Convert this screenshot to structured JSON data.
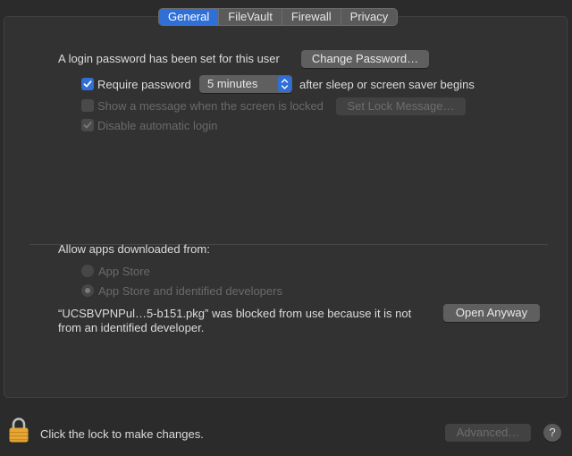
{
  "tabs": [
    {
      "label": "General",
      "active": true
    },
    {
      "label": "FileVault",
      "active": false
    },
    {
      "label": "Firewall",
      "active": false
    },
    {
      "label": "Privacy",
      "active": false
    }
  ],
  "login": {
    "text": "A login password has been set for this user",
    "change_password_label": "Change Password…"
  },
  "require_password": {
    "label": "Require password",
    "checked": true,
    "select_value": "5 minutes",
    "suffix": "after sleep or screen saver begins"
  },
  "show_message": {
    "label": "Show a message when the screen is locked",
    "checked": false,
    "enabled": false,
    "button_label": "Set Lock Message…"
  },
  "disable_auto_login": {
    "label": "Disable automatic login",
    "checked": true,
    "enabled": false
  },
  "allow_apps": {
    "heading": "Allow apps downloaded from:",
    "options": [
      {
        "label": "App Store",
        "selected": false
      },
      {
        "label": "App Store and identified developers",
        "selected": true
      }
    ]
  },
  "blocked": {
    "line1": "“UCSBVPNPul…5-b151.pkg” was blocked from use because it is not",
    "line2": "from an identified developer.",
    "open_anyway_label": "Open Anyway"
  },
  "footer": {
    "lock_text": "Click the lock to make changes.",
    "advanced_label": "Advanced…",
    "help_label": "?"
  },
  "colors": {
    "accent": "#2f6fd6",
    "lock": "#e6a734"
  }
}
